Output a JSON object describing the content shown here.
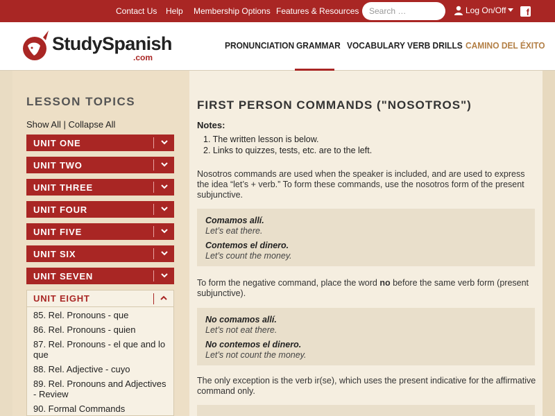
{
  "topbar": {
    "links": [
      "Contact Us",
      "Help",
      "Membership Options",
      "Features & Resources"
    ],
    "search_placeholder": "Search …",
    "login_label": "Log On/Off",
    "facebook_glyph": "f"
  },
  "brand": {
    "name": "StudySpanish",
    "suffix": ".com"
  },
  "nav": {
    "items": [
      "PRONUNCIATION",
      "GRAMMAR",
      "VOCABULARY",
      "VERB DRILLS",
      "CAMINO DEL ÉXITO"
    ],
    "active": "GRAMMAR",
    "accent_color": "#a92624",
    "gold_color": "#b37f45"
  },
  "sidebar": {
    "title": "LESSON TOPICS",
    "show_all": "Show All",
    "divider": "|",
    "collapse_all": "Collapse All",
    "units": [
      "UNIT ONE",
      "UNIT TWO",
      "UNIT THREE",
      "UNIT FOUR",
      "UNIT FIVE",
      "UNIT SIX",
      "UNIT SEVEN"
    ],
    "open_unit": "UNIT EIGHT",
    "topics": [
      "85. Rel. Pronouns - que",
      "86. Rel. Pronouns - quien",
      "87. Rel. Pronouns - el que and lo que",
      "88. Rel. Adjective - cuyo",
      "89. Rel. Pronouns and Adjectives - Review",
      "90. Formal Commands"
    ]
  },
  "content": {
    "title": "FIRST PERSON COMMANDS (\"NOSOTROS\")",
    "notes_label": "Notes:",
    "notes": [
      "1. The written lesson is below.",
      "2. Links to quizzes, tests, etc. are to the left."
    ],
    "para1": "Nosotros commands are used when the speaker is included, and are used to express the idea “let’s + verb.” To form these commands, use the nosotros form of the present subjunctive.",
    "examples1": [
      {
        "es": "Comamos allí.",
        "en": "Let’s eat there."
      },
      {
        "es": "Contemos el dinero.",
        "en": "Let’s count the money."
      }
    ],
    "para2_before": "To form the negative command, place the word ",
    "para2_bold": "no",
    "para2_after": " before the same verb form (present subjunctive).",
    "examples2": [
      {
        "es": "No comamos allí.",
        "en": "Let’s not eat there."
      },
      {
        "es": "No contemos el dinero.",
        "en": "Let’s not count the money."
      }
    ],
    "para3": "The only exception is the verb ir(se), which uses the present indicative for the affirmative command only."
  }
}
